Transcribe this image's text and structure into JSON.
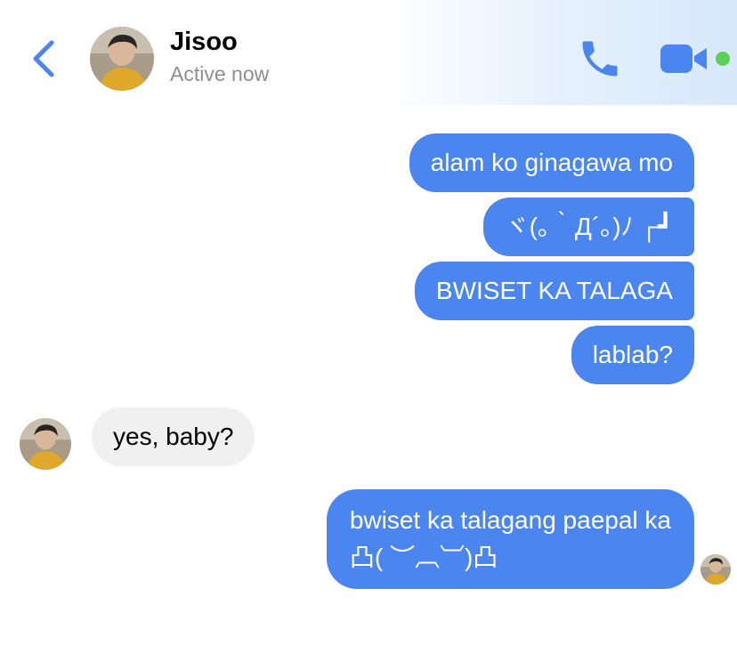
{
  "header": {
    "contact_name": "Jisoo",
    "status": "Active now",
    "icons": {
      "back": "chevron-left-icon",
      "call": "phone-icon",
      "video": "video-camera-icon",
      "online": "online-status-dot"
    },
    "accent_color": "#4b85f0",
    "online_color": "#5dd05a"
  },
  "messages": [
    {
      "sender": "me",
      "text": "alam ko ginagawa mo"
    },
    {
      "sender": "me",
      "text": "ヾ(｡｀Д´｡)ﾉ ┌┛"
    },
    {
      "sender": "me",
      "text": "BWISET KA TALAGA"
    },
    {
      "sender": "me",
      "text": "lablab?"
    },
    {
      "sender": "Jisoo",
      "text": "yes, baby?"
    },
    {
      "sender": "me",
      "text": "bwiset ka talagang paepal ka\n凸( ︶︹︺)凸"
    }
  ],
  "colors": {
    "outgoing_bubble": "#4b85f0",
    "incoming_bubble": "#f0f0f0"
  }
}
